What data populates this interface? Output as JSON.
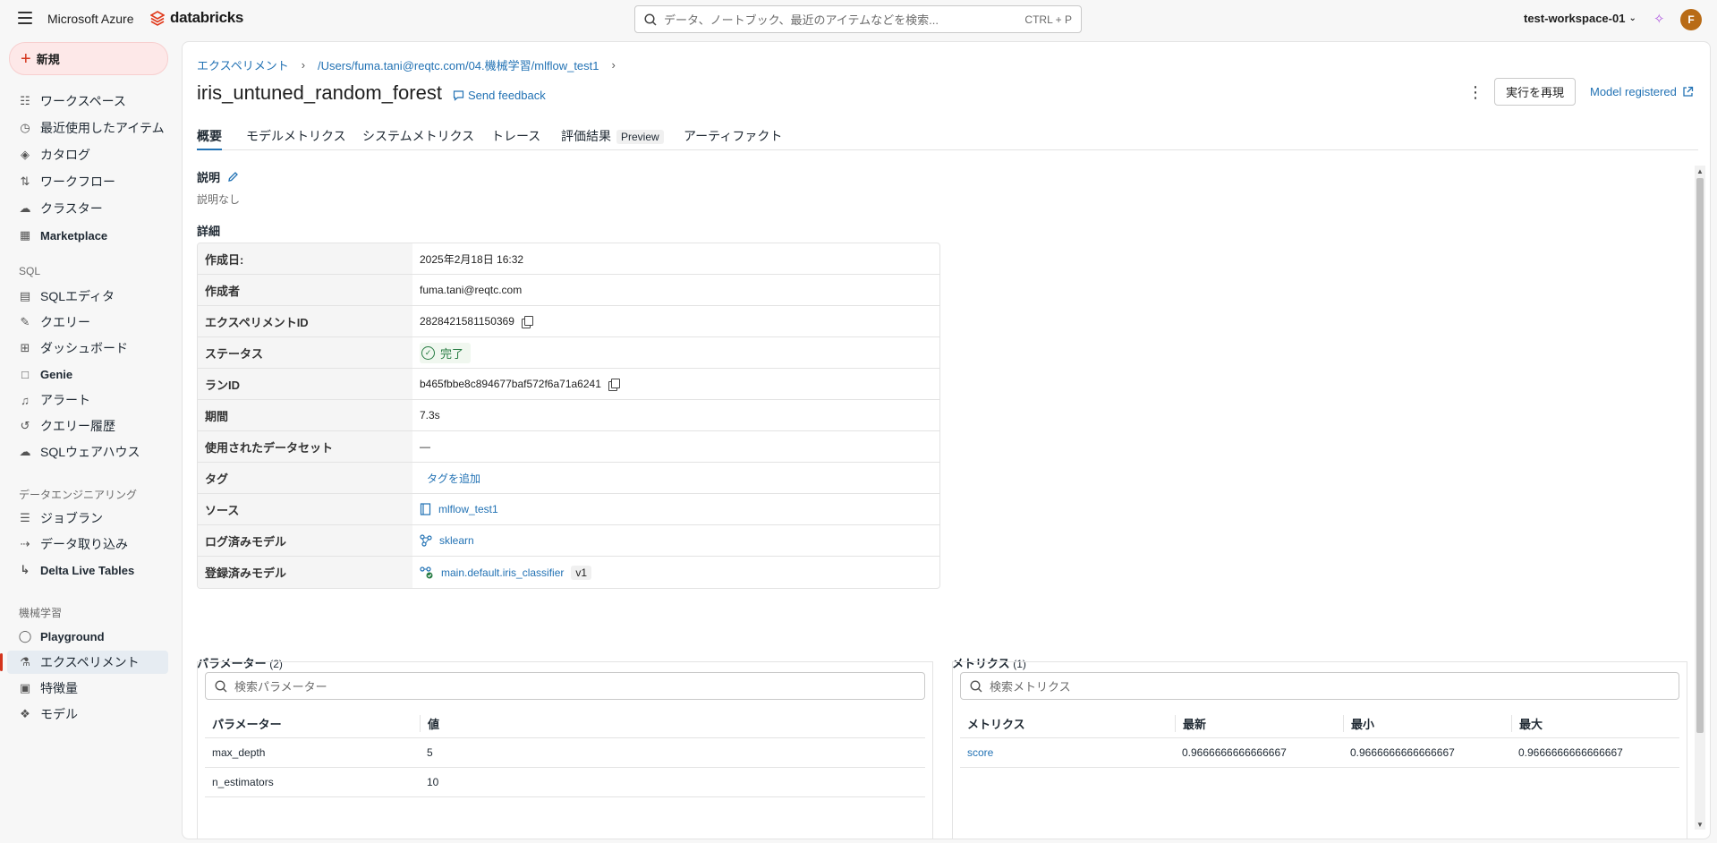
{
  "topbar": {
    "azure": "Microsoft Azure",
    "brand": "databricks",
    "search_placeholder": "データ、ノートブック、最近のアイテムなどを検索...",
    "search_shortcut": "CTRL + P",
    "workspace": "test-workspace-01",
    "avatar_initial": "F"
  },
  "sidebar": {
    "new_label": "新規",
    "items": [
      {
        "label": "ワークスペース",
        "icon": "workspace-icon"
      },
      {
        "label": "最近使用したアイテム",
        "icon": "clock-icon"
      },
      {
        "label": "カタログ",
        "icon": "catalog-icon"
      },
      {
        "label": "ワークフロー",
        "icon": "workflow-icon"
      },
      {
        "label": "クラスター",
        "icon": "cloud-icon"
      },
      {
        "label": "Marketplace",
        "icon": "store-icon"
      }
    ],
    "sql_section": "SQL",
    "sql_items": [
      {
        "label": "SQLエディタ",
        "icon": "sql-editor-icon"
      },
      {
        "label": "クエリー",
        "icon": "query-icon"
      },
      {
        "label": "ダッシュボード",
        "icon": "dashboard-icon"
      },
      {
        "label": "Genie",
        "icon": "genie-icon"
      },
      {
        "label": "アラート",
        "icon": "bell-icon"
      },
      {
        "label": "クエリー履歴",
        "icon": "history-icon"
      },
      {
        "label": "SQLウェアハウス",
        "icon": "warehouse-icon"
      }
    ],
    "de_section": "データエンジニアリング",
    "de_items": [
      {
        "label": "ジョブラン",
        "icon": "job-run-icon"
      },
      {
        "label": "データ取り込み",
        "icon": "ingest-icon"
      },
      {
        "label": "Delta Live Tables",
        "icon": "pipeline-icon"
      }
    ],
    "ml_section": "機械学習",
    "ml_items": [
      {
        "label": "Playground",
        "icon": "playground-icon"
      },
      {
        "label": "エクスペリメント",
        "icon": "flask-icon"
      },
      {
        "label": "特徴量",
        "icon": "feature-icon"
      },
      {
        "label": "モデル",
        "icon": "model-icon"
      }
    ]
  },
  "breadcrumb": {
    "root": "エクスペリメント",
    "path": "/Users/fuma.tani@reqtc.com/04.機械学習/mlflow_test1"
  },
  "header": {
    "title": "iris_untuned_random_forest",
    "feedback": "Send feedback",
    "rerun_label": "実行を再現",
    "model_registered": "Model registered"
  },
  "tabs": [
    {
      "label": "概要"
    },
    {
      "label": "モデルメトリクス"
    },
    {
      "label": "システムメトリクス"
    },
    {
      "label": "トレース"
    },
    {
      "label": "評価結果",
      "badge": "Preview"
    },
    {
      "label": "アーティファクト"
    }
  ],
  "description": {
    "title": "説明",
    "text": "説明なし"
  },
  "details": {
    "title": "詳細",
    "rows": {
      "created_key": "作成日:",
      "created_val": "2025年2月18日 16:32",
      "author_key": "作成者",
      "author_val": "fuma.tani@reqtc.com",
      "exp_id_key": "エクスペリメントID",
      "exp_id_val": "2828421581150369",
      "status_key": "ステータス",
      "status_val": "完了",
      "run_id_key": "ランID",
      "run_id_val": "b465fbbe8c894677baf572f6a71a6241",
      "duration_key": "期間",
      "duration_val": "7.3s",
      "dataset_key": "使用されたデータセット",
      "dataset_val": "—",
      "tags_key": "タグ",
      "tags_val": "タグを追加",
      "source_key": "ソース",
      "source_val": "mlflow_test1",
      "logged_key": "ログ済みモデル",
      "logged_val": "sklearn",
      "registered_key": "登録済みモデル",
      "registered_val": "main.default.iris_classifier",
      "registered_ver": "v1"
    }
  },
  "params": {
    "title": "パラメーター",
    "count": "(2)",
    "search_placeholder": "検索パラメーター",
    "col_name": "パラメーター",
    "col_value": "値",
    "rows": [
      {
        "name": "max_depth",
        "value": "5"
      },
      {
        "name": "n_estimators",
        "value": "10"
      }
    ]
  },
  "metrics": {
    "title": "メトリクス",
    "count": "(1)",
    "search_placeholder": "検索メトリクス",
    "col_name": "メトリクス",
    "col_latest": "最新",
    "col_min": "最小",
    "col_max": "最大",
    "rows": [
      {
        "name": "score",
        "latest": "0.9666666666666667",
        "min": "0.9666666666666667",
        "max": "0.9666666666666667"
      }
    ]
  },
  "colors": {
    "accent": "#2272b4",
    "brand_red": "#d4341c",
    "success": "#277c43"
  }
}
